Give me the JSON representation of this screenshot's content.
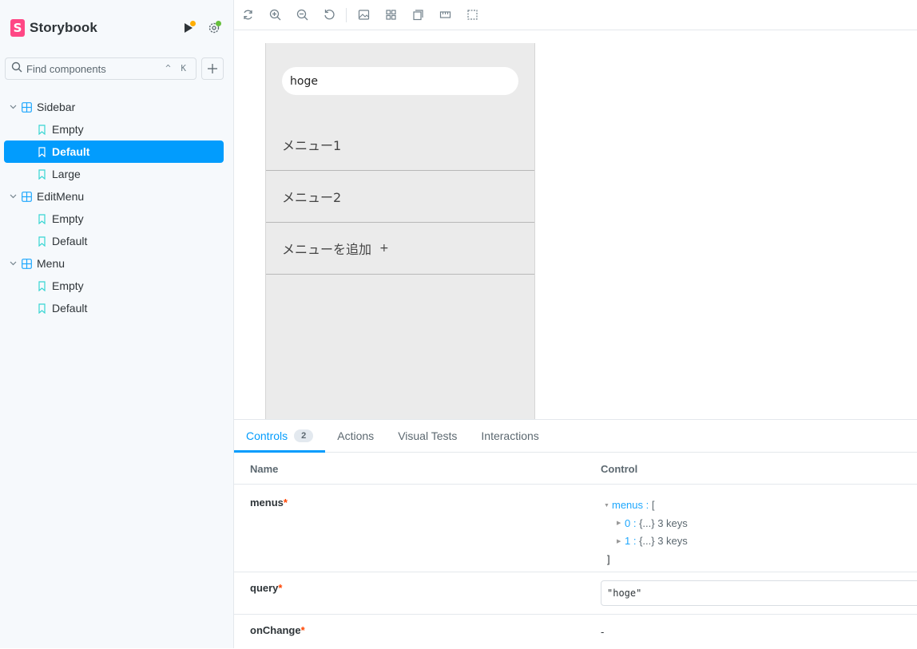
{
  "brand": {
    "name": "Storybook",
    "logo_letter": "S",
    "accent": "#ff4785"
  },
  "header_icons": [
    {
      "name": "play-icon",
      "dot_color": "#ffae00"
    },
    {
      "name": "gear-icon",
      "dot_color": "#66bf3c"
    }
  ],
  "search": {
    "placeholder": "Find components",
    "shortcut": "^ K"
  },
  "tree": {
    "groups": [
      {
        "label": "Sidebar",
        "stories": [
          {
            "label": "Empty"
          },
          {
            "label": "Default",
            "active": true
          },
          {
            "label": "Large"
          }
        ]
      },
      {
        "label": "EditMenu",
        "stories": [
          {
            "label": "Empty"
          },
          {
            "label": "Default"
          }
        ]
      },
      {
        "label": "Menu",
        "stories": [
          {
            "label": "Empty"
          },
          {
            "label": "Default"
          }
        ]
      }
    ]
  },
  "toolbar": {
    "tools": [
      "remount-icon",
      "zoom-in-icon",
      "zoom-out-icon",
      "zoom-reset-icon",
      "background-icon",
      "grid-icon",
      "viewport-icon",
      "measure-icon",
      "outline-icon"
    ]
  },
  "preview": {
    "search_value": "hoge",
    "menu_items": [
      {
        "label": "メニュー1"
      },
      {
        "label": "メニュー2"
      },
      {
        "label": "メニューを追加",
        "suffix": "+"
      }
    ]
  },
  "panel": {
    "tabs": [
      {
        "label": "Controls",
        "badge": "2",
        "active": true
      },
      {
        "label": "Actions"
      },
      {
        "label": "Visual Tests"
      },
      {
        "label": "Interactions"
      }
    ],
    "columns": {
      "name": "Name",
      "control": "Control"
    },
    "rows": {
      "menus": {
        "name": "menus",
        "required": "*",
        "root_key": "menus",
        "root_open": "[",
        "items": [
          {
            "key": "0",
            "value": "{...} 3 keys"
          },
          {
            "key": "1",
            "value": "{...} 3 keys"
          }
        ],
        "root_close": "]"
      },
      "query": {
        "name": "query",
        "required": "*",
        "value": "\"hoge\""
      },
      "onChange": {
        "name": "onChange",
        "required": "*",
        "value": "-"
      }
    }
  },
  "colors": {
    "primary": "#029cfd",
    "sidebar_bg": "#f6f9fc",
    "story_icon": "#37d5d3",
    "component_icon": "#1ea7fd"
  }
}
